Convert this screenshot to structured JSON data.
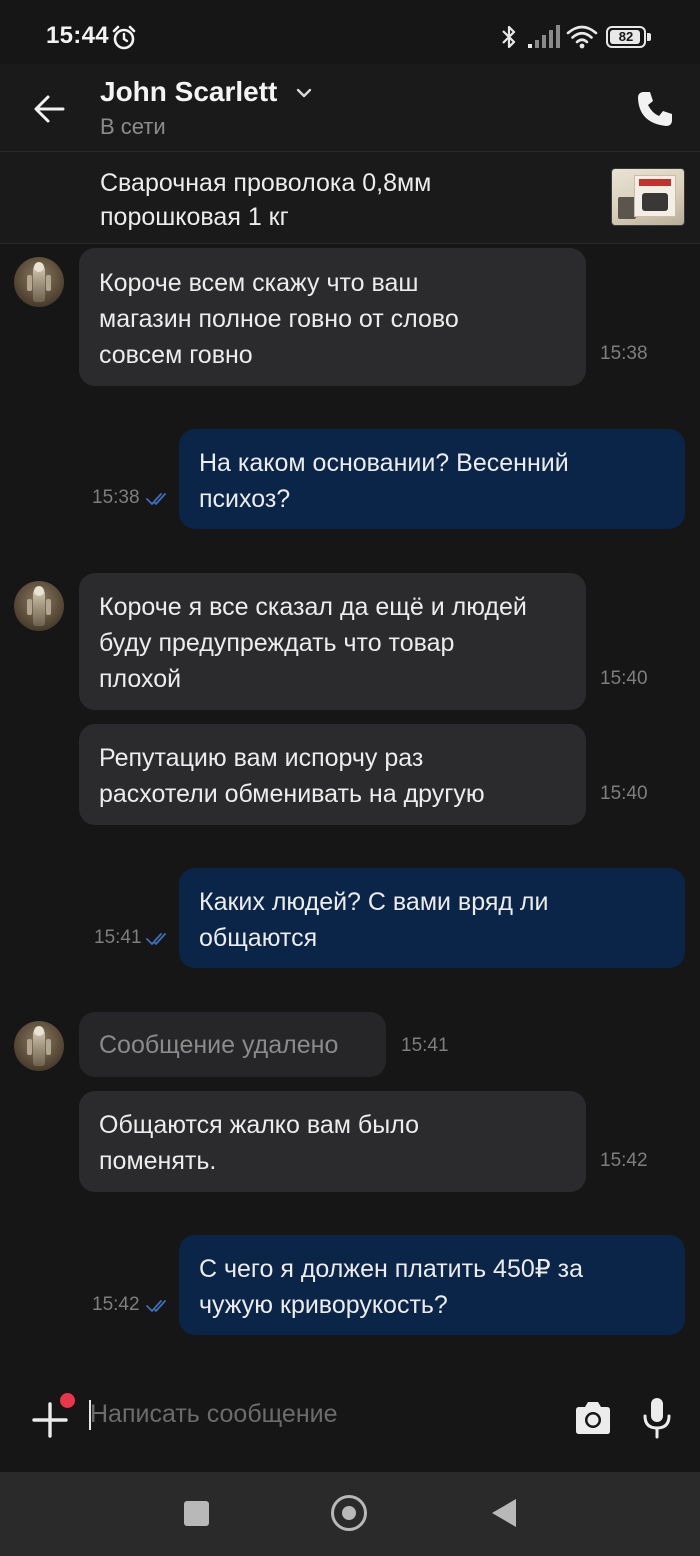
{
  "status_bar": {
    "time": "15:44",
    "battery": "82"
  },
  "header": {
    "contact_name": "John Scarlett",
    "contact_status": "В сети"
  },
  "product": {
    "title": "Сварочная проволока 0,8мм\nпорошковая 1 кг"
  },
  "messages": [
    {
      "from": "them",
      "text": "Короче всем скажу что ваш\nмагазин полное говно от слово\nсовсем говно",
      "time": "15:38"
    },
    {
      "from": "me",
      "text": "На каком основании? Весенний\nпсихоз?",
      "time": "15:38",
      "status": "read"
    },
    {
      "from": "them",
      "text": "Короче я все сказал да ещё и людей\nбуду предупреждать что товар\nплохой",
      "time": "15:40"
    },
    {
      "from": "them",
      "text": "Репутацию вам испорчу раз\nрасхотели  обменивать на другую",
      "time": "15:40"
    },
    {
      "from": "me",
      "text": "Каких людей? С вами вряд ли\nобщаются",
      "time": "15:41",
      "status": "read"
    },
    {
      "from": "them",
      "text": "Сообщение удалено",
      "time": "15:41",
      "deleted": true
    },
    {
      "from": "them",
      "text": "Общаются жалко вам было\nпоменять.",
      "time": "15:42"
    },
    {
      "from": "me",
      "text": "С чего я должен платить 450₽ за\nчужую криворукость?",
      "time": "15:42",
      "status": "read"
    }
  ],
  "composer": {
    "placeholder": "Написать сообщение"
  },
  "colors": {
    "incoming_bubble": "#2b2b2d",
    "outgoing_bubble": "#0a2547",
    "read_tick": "#3d6fb8",
    "badge": "#e8364a"
  }
}
